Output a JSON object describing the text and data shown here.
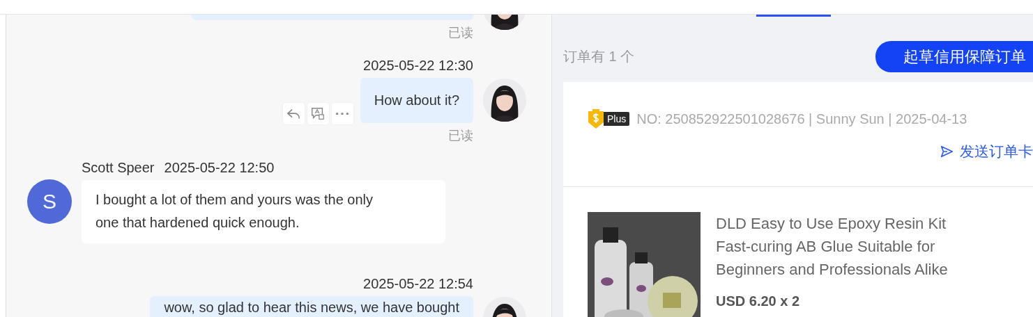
{
  "chat": {
    "messages": [
      {
        "kind": "outgoing",
        "status": "已读"
      },
      {
        "kind": "outgoing",
        "time": "2025-05-22 12:30",
        "text": "How about it?",
        "status": "已读",
        "show_actions": true
      },
      {
        "kind": "incoming",
        "sender": "Scott Speer",
        "initial": "S",
        "time": "2025-05-22 12:50",
        "text": "I bought a lot of them and yours was the only one that hardened quick enough."
      },
      {
        "kind": "outgoing",
        "time": "2025-05-22 12:54",
        "text": "wow, so glad to hear this news, we have bought"
      }
    ]
  },
  "orders": {
    "count_label": "订单有 1 个",
    "draft_button": "起草信用保障订单",
    "cards": [
      {
        "badge": "Plus",
        "meta": "NO: 250852922501028676 | Sunny Sun | 2025-04-13",
        "send_link": "发送订单卡",
        "product": {
          "kind": "picture",
          "title": "DLD Easy to Use Epoxy Resin Kit Fast-curing AB Glue Suitable for Beginners and Professionals Alike",
          "price": "USD 6.20 x 2"
        }
      }
    ]
  }
}
